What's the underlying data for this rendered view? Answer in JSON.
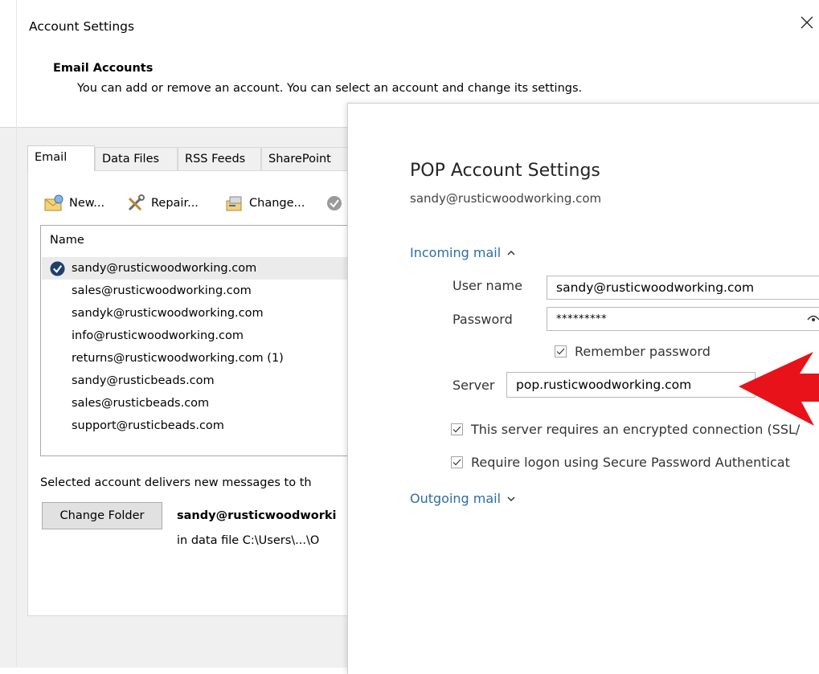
{
  "dialog": {
    "title": "Account Settings",
    "header_title": "Email Accounts",
    "header_desc": "You can add or remove an account. You can select an account and change its settings."
  },
  "tabs": [
    {
      "label": "Email",
      "active": true
    },
    {
      "label": "Data Files"
    },
    {
      "label": "RSS Feeds"
    },
    {
      "label": "SharePoint"
    }
  ],
  "toolbar": {
    "new_label": "New...",
    "repair_label": "Repair...",
    "change_label": "Change..."
  },
  "account_list": {
    "header": "Name",
    "accounts": [
      {
        "email": "sandy@rusticwoodworking.com",
        "default": true
      },
      {
        "email": "sales@rusticwoodworking.com"
      },
      {
        "email": "sandyk@rusticwoodworking.com"
      },
      {
        "email": "info@rusticwoodworking.com"
      },
      {
        "email": "returns@rusticwoodworking.com (1)"
      },
      {
        "email": "sandy@rusticbeads.com"
      },
      {
        "email": "sales@rusticbeads.com"
      },
      {
        "email": "support@rusticbeads.com"
      }
    ]
  },
  "delivery": {
    "note": "Selected account delivers new messages to th",
    "change_folder_label": "Change Folder",
    "account": "sandy@rusticwoodworki",
    "path": "in data file C:\\Users\\...\\O"
  },
  "pop": {
    "title": "POP Account Settings",
    "email": "sandy@rusticwoodworking.com",
    "incoming_label": "Incoming mail",
    "user_name_label": "User name",
    "user_name_value": "sandy@rusticwoodworking.com",
    "password_label": "Password",
    "password_value": "*********",
    "remember_password_label": "Remember password",
    "remember_password_checked": true,
    "server_label": "Server",
    "server_value": "pop.rusticwoodworking.com",
    "ssl_label": "This server requires an encrypted connection (SSL/",
    "ssl_checked": true,
    "spa_label": "Require logon using Secure Password Authenticat",
    "spa_checked": true,
    "outgoing_label": "Outgoing mail"
  },
  "colors": {
    "accent_link": "#2e6da4",
    "arrow": "#e8131a",
    "check_badge": "#1f3f6b"
  }
}
